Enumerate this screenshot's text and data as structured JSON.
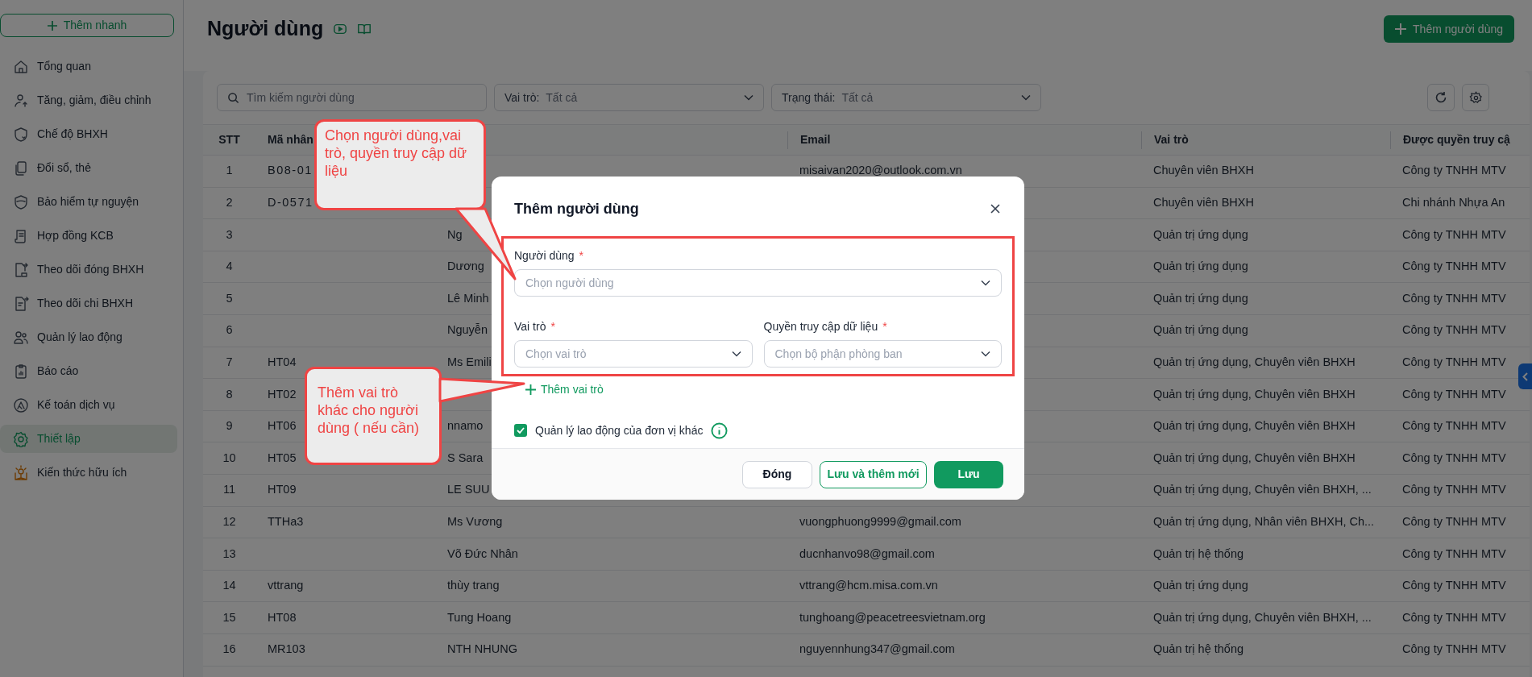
{
  "sidebar": {
    "quick_add": "Thêm nhanh",
    "items": [
      {
        "label": "Tổng quan",
        "selected": false
      },
      {
        "label": "Tăng, giảm, điều chỉnh",
        "selected": false
      },
      {
        "label": "Chế độ BHXH",
        "selected": false
      },
      {
        "label": "Đổi sổ, thẻ",
        "selected": false
      },
      {
        "label": "Bảo hiểm tự nguyện",
        "selected": false
      },
      {
        "label": "Hợp đồng KCB",
        "selected": false
      },
      {
        "label": "Theo dõi đóng BHXH",
        "selected": false
      },
      {
        "label": "Theo dõi chi BHXH",
        "selected": false
      },
      {
        "label": "Quản lý lao động",
        "selected": false
      },
      {
        "label": "Báo cáo",
        "selected": false
      },
      {
        "label": "Kế toán dịch vụ",
        "selected": false
      },
      {
        "label": "Thiết lập",
        "selected": true
      },
      {
        "label": "Kiến thức hữu ích",
        "selected": false
      }
    ]
  },
  "page": {
    "title": "Người dùng",
    "add_button": "Thêm người dùng"
  },
  "filters": {
    "search": {
      "placeholder": "Tìm kiếm người dùng"
    },
    "role": {
      "label": "Vai trò:",
      "value": "Tất cả"
    },
    "status": {
      "label": "Trạng thái:",
      "value": "Tất cả"
    }
  },
  "table": {
    "columns": [
      "STT",
      "Mã nhân",
      "",
      "Email",
      "Vai trò",
      "Được quyền truy cậ"
    ],
    "rows": [
      {
        "stt": "1",
        "code": "B08-01",
        "email": "misaivan2020@outlook.com.vn",
        "role": "Chuyên viên BHXH",
        "access": "Công ty TNHH MTV"
      },
      {
        "stt": "2",
        "code": "D-0571",
        "role": "Chuyên viên BHXH",
        "access": "Chi nhánh Nhựa An"
      },
      {
        "stt": "3",
        "name": "Ng",
        "role": "Quản trị ứng dụng",
        "access": "Công ty TNHH MTV"
      },
      {
        "stt": "4",
        "name": "Dương",
        "role": "Quản trị ứng dụng",
        "access": "Công ty TNHH MTV"
      },
      {
        "stt": "5",
        "name": "Lê Minh",
        "role": "Quản trị ứng dụng",
        "access": "Công ty TNHH MTV"
      },
      {
        "stt": "6",
        "name": "Nguyễn",
        "role": "Quản trị ứng dụng",
        "access": "Công ty TNHH MTV"
      },
      {
        "stt": "7",
        "code": "HT04",
        "name": "Ms Emili",
        "role": "Quản trị ứng dụng, Chuyên viên BHXH",
        "access": "Công ty TNHH MTV"
      },
      {
        "stt": "8",
        "code": "HT02",
        "role": "Quản trị ứng dụng, Chuyên viên BHXH",
        "access": "Công ty TNHH MTV"
      },
      {
        "stt": "9",
        "code": "HT06",
        "name": "nnamo",
        "role": "Quản trị ứng dụng, Chuyên viên BHXH",
        "access": "Công ty TNHH MTV"
      },
      {
        "stt": "10",
        "code": "HT05",
        "name": "S Sara",
        "role": "Quản trị ứng dụng, Chuyên viên BHXH",
        "access": "Công ty TNHH MTV"
      },
      {
        "stt": "11",
        "code": "HT09",
        "name": "LE SUU",
        "role": "Quản trị ứng dụng, Chuyên viên BHXH, ...",
        "access": "Công ty TNHH MTV"
      },
      {
        "stt": "12",
        "code": "TTHa3",
        "name": "Ms Vương",
        "email": "vuongphuong9999@gmail.com",
        "role": "Quản trị ứng dụng, Nhân viên BHXH, Ch...",
        "access": "Công ty TNHH MTV"
      },
      {
        "stt": "13",
        "name": "Võ Đức Nhân",
        "email": "ducnhanvo98@gmail.com",
        "role": "Quản trị hệ thống",
        "access": "Công ty TNHH MTV"
      },
      {
        "stt": "14",
        "code": "vttrang",
        "name": "thùy trang",
        "email": "vttrang@hcm.misa.com.vn",
        "role": "Quản trị ứng dụng",
        "access": "Công ty TNHH MTV"
      },
      {
        "stt": "15",
        "code": "HT08",
        "name": "Tung Hoang",
        "email": "tunghoang@peacetreesvietnam.org",
        "role": "Quản trị ứng dụng, Chuyên viên BHXH, ...",
        "access": "Công ty TNHH MTV"
      },
      {
        "stt": "16",
        "code": "MR103",
        "name": "NTH NHUNG",
        "email": "nguyennhung347@gmail.com",
        "role": "Quản trị hệ thống",
        "access": "Công ty TNHH MTV"
      }
    ]
  },
  "modal": {
    "title": "Thêm người dùng",
    "required_mark": "*",
    "user_field": {
      "label": "Người dùng",
      "placeholder": "Chọn người dùng"
    },
    "role_field": {
      "label": "Vai trò",
      "placeholder": "Chọn vai trò"
    },
    "access_field": {
      "label": "Quyền truy cập dữ liệu",
      "placeholder": "Chọn bộ phận phòng ban"
    },
    "add_role": "Thêm vai trò",
    "manage_other": {
      "label": "Quản lý lao động của đơn vị khác",
      "checked": true
    },
    "buttons": [
      {
        "label": "Đóng",
        "kind": "plain"
      },
      {
        "label": "Lưu và thêm mới",
        "kind": "outline"
      },
      {
        "label": "Lưu",
        "kind": "primary"
      }
    ]
  },
  "annotations": [
    {
      "text": "Chọn người dùng,vai trò, quyền truy cập dữ liệu"
    },
    {
      "text": "Thêm vai trò khác cho người dùng ( nếu cần)"
    }
  ]
}
